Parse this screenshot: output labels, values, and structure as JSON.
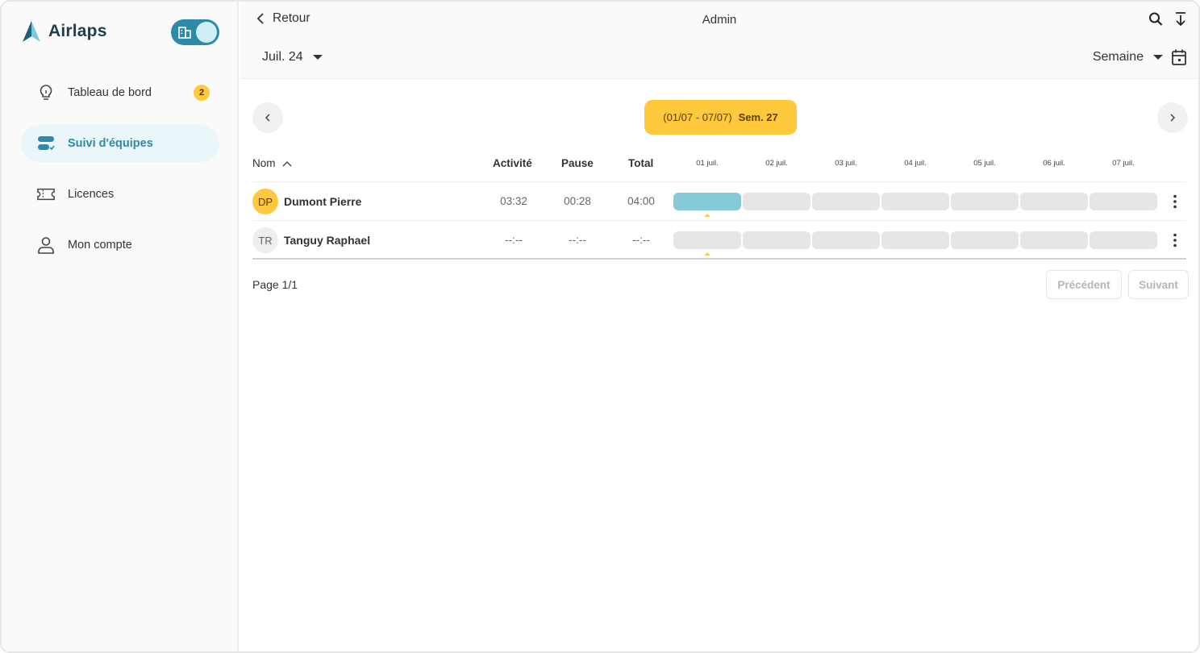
{
  "app": {
    "name": "Airlaps"
  },
  "sidebar": {
    "items": [
      {
        "label": "Tableau de bord",
        "icon": "lightbulb-icon",
        "badge": "2"
      },
      {
        "label": "Suivi d'équipes",
        "icon": "team-tracking-icon",
        "active": true
      },
      {
        "label": "Licences",
        "icon": "ticket-icon"
      },
      {
        "label": "Mon compte",
        "icon": "user-icon"
      }
    ]
  },
  "header": {
    "back_label": "Retour",
    "title": "Admin",
    "month": "Juil. 24",
    "view": "Semaine"
  },
  "week": {
    "range": "(01/07 - 07/07)",
    "label": "Sem. 27"
  },
  "table": {
    "columns": {
      "name": "Nom",
      "activity": "Activité",
      "pause": "Pause",
      "total": "Total"
    },
    "days": [
      "01 juil.",
      "02 juil.",
      "03 juil.",
      "04 juil.",
      "05 juil.",
      "06 juil.",
      "07 juil."
    ],
    "rows": [
      {
        "initials": "DP",
        "name": "Dumont Pierre",
        "activity": "03:32",
        "pause": "00:28",
        "total": "04:00",
        "active_days": [
          0
        ]
      },
      {
        "initials": "TR",
        "name": "Tanguy Raphael",
        "activity": "--:--",
        "pause": "--:--",
        "total": "--:--",
        "active_days": []
      }
    ]
  },
  "pagination": {
    "info": "Page 1/1",
    "prev": "Précédent",
    "next": "Suivant"
  },
  "colors": {
    "accent": "#2e8aa6",
    "highlight": "#ffc83d",
    "bar_active": "#86c9d8",
    "bar_empty": "#e6e6e6"
  }
}
